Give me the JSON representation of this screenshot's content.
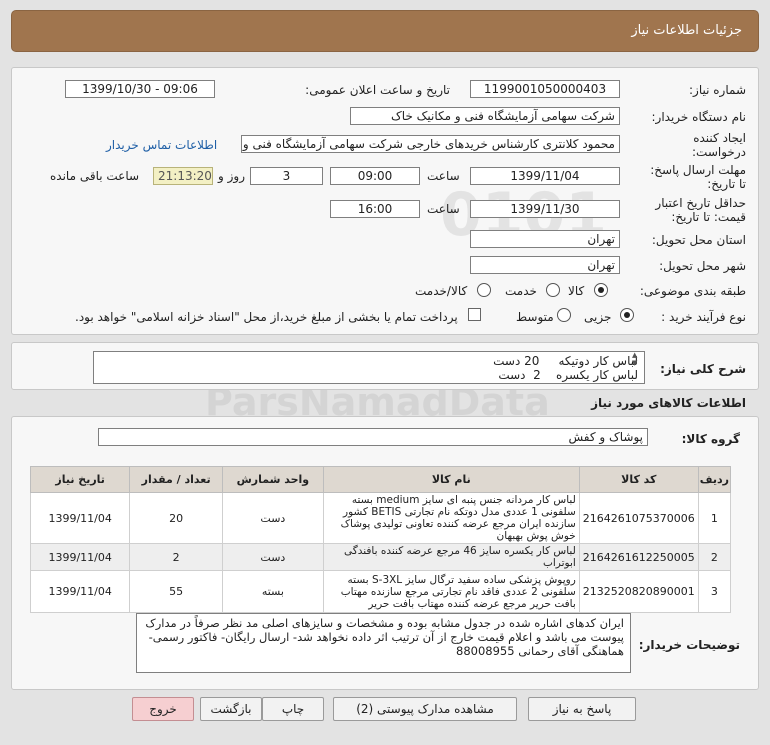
{
  "header": {
    "title": "جزئیات اطلاعات نیاز"
  },
  "form": {
    "need_number_label": "شماره نیاز:",
    "need_number": "1199001050000403",
    "announce_label": "تاریخ و ساعت اعلان عمومی:",
    "announce_value": "1399/10/30 - 09:06",
    "buyer_org_label": "نام دستگاه خریدار:",
    "buyer_org": "شرکت سهامی آزمایشگاه فنی و مکانیک خاک",
    "creator_label_1": "ایجاد کننده",
    "creator_label_2": "درخواست:",
    "creator_value": "محمود کلانتری کارشناس خریدهای خارجی  شرکت سهامی آزمایشگاه فنی و مکانیک خاک",
    "contact_link": "اطلاعات تماس خریدار",
    "reply_deadline_label_1": "مهلت ارسال پاسخ:",
    "reply_deadline_label_2": "تا تاریخ:",
    "reply_date": "1399/11/04",
    "time_label": "ساعت",
    "reply_time": "09:00",
    "days_value": "3",
    "days_label": "روز و",
    "remaining_time": "21:13:20",
    "remaining_label": "ساعت باقی مانده",
    "validity_label_1": "حداقل تاریخ اعتبار",
    "validity_label_2": "قیمت: تا تاریخ:",
    "validity_date": "1399/11/30",
    "validity_time": "16:00",
    "province_label": "استان محل تحویل:",
    "province": "تهران",
    "city_label": "شهر محل تحویل:",
    "city": "تهران",
    "category_label": "طبقه بندی موضوعی:",
    "category_options": [
      "کالا",
      "خدمت",
      "کالا/خدمت"
    ],
    "category_selected": "کالا",
    "process_label": "نوع فرآیند خرید :",
    "process_options": [
      "جزیی",
      "متوسط"
    ],
    "process_selected": "جزیی",
    "treasury_text": "پرداخت تمام یا بخشی از مبلغ خرید،از محل \"اسناد خزانه اسلامی\" خواهد بود."
  },
  "summary": {
    "label": "شرح کلی نیاز:",
    "line1": "لباس کار دوتیکه     20 دست",
    "line2": "لباس کار یکسره    2  دست"
  },
  "goods": {
    "section_title": "اطلاعات کالاهای مورد نیاز",
    "group_label": "گروه کالا:",
    "group_value": "پوشاک و کفش",
    "columns": [
      "ردیف",
      "کد کالا",
      "نام کالا",
      "واحد شمارش",
      "تعداد / مقدار",
      "تاریخ نیاز"
    ],
    "rows": [
      {
        "index": "1",
        "code": "2164261075370006",
        "name": "لباس کار مردانه جنس پنبه ای سایز medium بسته سلفونی 1 عددی مدل دوتکه نام تجارتی BETIS کشور سازنده ایران مرجع عرضه کننده تعاونی تولیدی پوشاک خوش پوش بهبهان",
        "unit": "دست",
        "qty": "20",
        "date": "1399/11/04"
      },
      {
        "index": "2",
        "code": "2164261612250005",
        "name": "لباس کار یکسره سایز 46 مرجع عرضه کننده بافندگی ابوتراب",
        "unit": "دست",
        "qty": "2",
        "date": "1399/11/04"
      },
      {
        "index": "3",
        "code": "2132520820890001",
        "name": "روپوش پزشکی ساده سفید ترگال سایز S-3XL بسته سلفونی 2 عددی فاقد نام تجارتی مرجع سازنده مهتاب بافت حریر مرجع عرضه کننده مهتاب بافت حریر",
        "unit": "بسته",
        "qty": "55",
        "date": "1399/11/04"
      }
    ]
  },
  "notes": {
    "label": "توضیحات خریدار:",
    "text": "ایران کدهای اشاره شده در جدول مشابه بوده و مشخصات و سایزهای اصلی مد نظر  صرفاً در مدارک پیوست می باشد و  اعلام قیمت خارج از آن ترتیب اثر داده نخواهد شد- ارسال رایگان- فاکتور رسمی- هماهنگی آقای رحمانی 88008955"
  },
  "buttons": {
    "reply": "پاسخ به نیاز",
    "view_docs": "مشاهده مدارک پیوستی (2)",
    "print": "چاپ",
    "back": "بازگشت",
    "exit": "خروج"
  },
  "colors": {
    "header": "#a0754e",
    "exit_button": "#f6cfd1",
    "timer_bg": "#f3f0c4",
    "link": "#1f5fa6"
  }
}
